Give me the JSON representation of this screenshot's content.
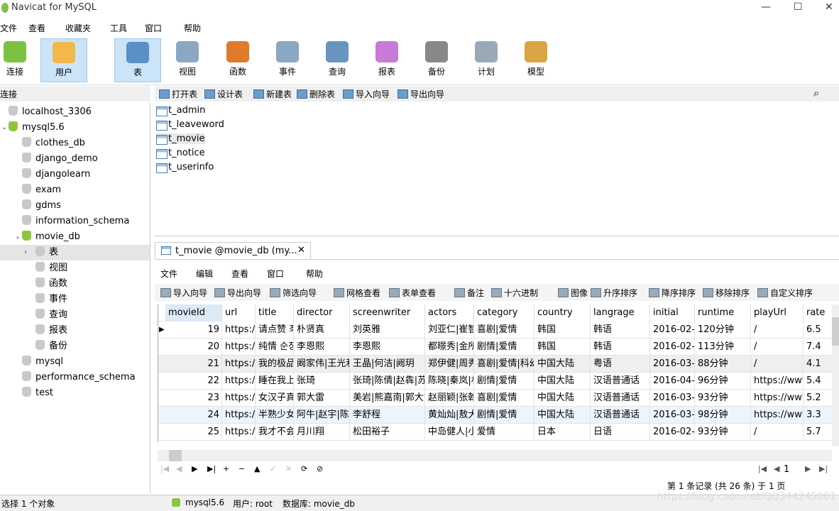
{
  "window": {
    "title": "Navicat for MySQL",
    "minimize": "—",
    "maximize": "☐",
    "close": "✕"
  },
  "menu": [
    "文件",
    "查看",
    "收藏夹",
    "工具",
    "窗口",
    "帮助"
  ],
  "toolbar": [
    {
      "label": "连接",
      "color": "#7cc242"
    },
    {
      "label": "用户",
      "color": "#f2b84b",
      "selected": true
    },
    {
      "label": "表",
      "color": "#5b8fc7",
      "selected": true
    },
    {
      "label": "视图",
      "color": "#8aa7c4"
    },
    {
      "label": "函数",
      "color": "#e07b2a"
    },
    {
      "label": "事件",
      "color": "#8aa7c4"
    },
    {
      "label": "查询",
      "color": "#6a94c0"
    },
    {
      "label": "报表",
      "color": "#c77ad8"
    },
    {
      "label": "备份",
      "color": "#888888"
    },
    {
      "label": "计划",
      "color": "#9aa9b8"
    },
    {
      "label": "模型",
      "color": "#d9a441"
    }
  ],
  "connections_header": "连接",
  "object_toolbar": [
    "打开表",
    "设计表",
    "新建表",
    "删除表",
    "导入向导",
    "导出向导"
  ],
  "tree": [
    {
      "label": "localhost_3306",
      "level": 0
    },
    {
      "label": "mysql5.6",
      "level": 0,
      "expanded": true,
      "green": true
    },
    {
      "label": "clothes_db",
      "level": 1
    },
    {
      "label": "django_demo",
      "level": 1
    },
    {
      "label": "djangolearn",
      "level": 1
    },
    {
      "label": "exam",
      "level": 1
    },
    {
      "label": "gdms",
      "level": 1
    },
    {
      "label": "information_schema",
      "level": 1
    },
    {
      "label": "movie_db",
      "level": 1,
      "expanded": true,
      "green": true
    },
    {
      "label": "表",
      "level": 2,
      "selected": true
    },
    {
      "label": "视图",
      "level": 2
    },
    {
      "label": "函数",
      "level": 2
    },
    {
      "label": "事件",
      "level": 2
    },
    {
      "label": "查询",
      "level": 2
    },
    {
      "label": "报表",
      "level": 2
    },
    {
      "label": "备份",
      "level": 2
    },
    {
      "label": "mysql",
      "level": 1
    },
    {
      "label": "performance_schema",
      "level": 1
    },
    {
      "label": "test",
      "level": 1
    }
  ],
  "tables": [
    "t_admin",
    "t_leaveword",
    "t_movie",
    "t_notice",
    "t_userinfo"
  ],
  "tab": {
    "label": "t_movie @movie_db (my...",
    "close": "✕"
  },
  "sub_menu": [
    "文件",
    "编辑",
    "查看",
    "窗口",
    "帮助"
  ],
  "sub_toolbar": [
    "导入向导",
    "导出向导",
    "筛选向导",
    "网格查看",
    "表单查看",
    "备注",
    "十六进制",
    "图像",
    "升序排序",
    "降序排序",
    "移除排序",
    "自定义排序"
  ],
  "grid": {
    "columns": [
      "movieId",
      "url",
      "title",
      "director",
      "screenwriter",
      "actors",
      "category",
      "country",
      "langrage",
      "initial",
      "runtime",
      "playUrl",
      "rate"
    ],
    "rows": [
      [
        "19",
        "https:/.",
        "请点赞 죄",
        "朴贤真",
        "刘英雅",
        "刘亚仁|崔智",
        "喜剧|爱情",
        "韩国",
        "韩语",
        "2016-02-",
        "120分钟",
        "/",
        "6.5"
      ],
      [
        "20",
        "https:/.",
        "纯情 순정",
        "李恩熙",
        "李恩熙",
        "都暻秀|金所",
        "剧情|爱情",
        "韩国",
        "韩语",
        "2016-02-",
        "113分钟",
        "/",
        "7.4"
      ],
      [
        "21",
        "https:/.",
        "我的极品",
        "阚家伟|王光利",
        "王晶|何洁|阙玥",
        "郑伊健|周秀",
        "喜剧|爱情|科幻",
        "中国大陆",
        "粤语",
        "2016-03-",
        "88分钟",
        "/",
        "4.1"
      ],
      [
        "22",
        "https:/.",
        "睡在我上",
        "张琦",
        "张琦|陈倩|赵犇|苏",
        "陈晓|秦岚|林",
        "剧情|爱情",
        "中国大陆",
        "汉语普通话",
        "2016-04-",
        "96分钟",
        "https://www",
        "5.4"
      ],
      [
        "23",
        "https:/.",
        "女汉子真",
        "郭大雷",
        "美岩|熊嘉南|郭大雷",
        "赵丽颖|张翰",
        "喜剧|爱情",
        "中国大陆",
        "汉语普通话",
        "2016-03-",
        "93分钟",
        "https://www",
        "5.2"
      ],
      [
        "24",
        "https:/.",
        "半熟少女",
        "阿牛|赵宇|陈",
        "李舒程",
        "黄灿灿|敖犬",
        "剧情|爱情",
        "中国大陆",
        "汉语普通话",
        "2016-03-",
        "98分钟",
        "https://www",
        "3.3"
      ],
      [
        "25",
        "https:/.",
        "我才不会",
        "月川翔",
        "松田裕子",
        "中岛健人|小",
        "爱情",
        "日本",
        "日语",
        "2016-02-",
        "93分钟",
        "/",
        "5.7"
      ]
    ]
  },
  "nav": {
    "buttons": [
      "|◀",
      "◀",
      "▶",
      "▶|",
      "+",
      "−",
      "▲",
      "✓",
      "✕",
      "⟳",
      "⊘"
    ],
    "page": "1"
  },
  "record_status": "第 1 条记录 (共 26 条) 于 1 页",
  "status": {
    "left": "选择 1 个对象",
    "connection": "mysql5.6",
    "user": "用户: root",
    "database": "数据库: movie_db"
  },
  "watermark": "https://blog.csdn.net/QQ344245001"
}
